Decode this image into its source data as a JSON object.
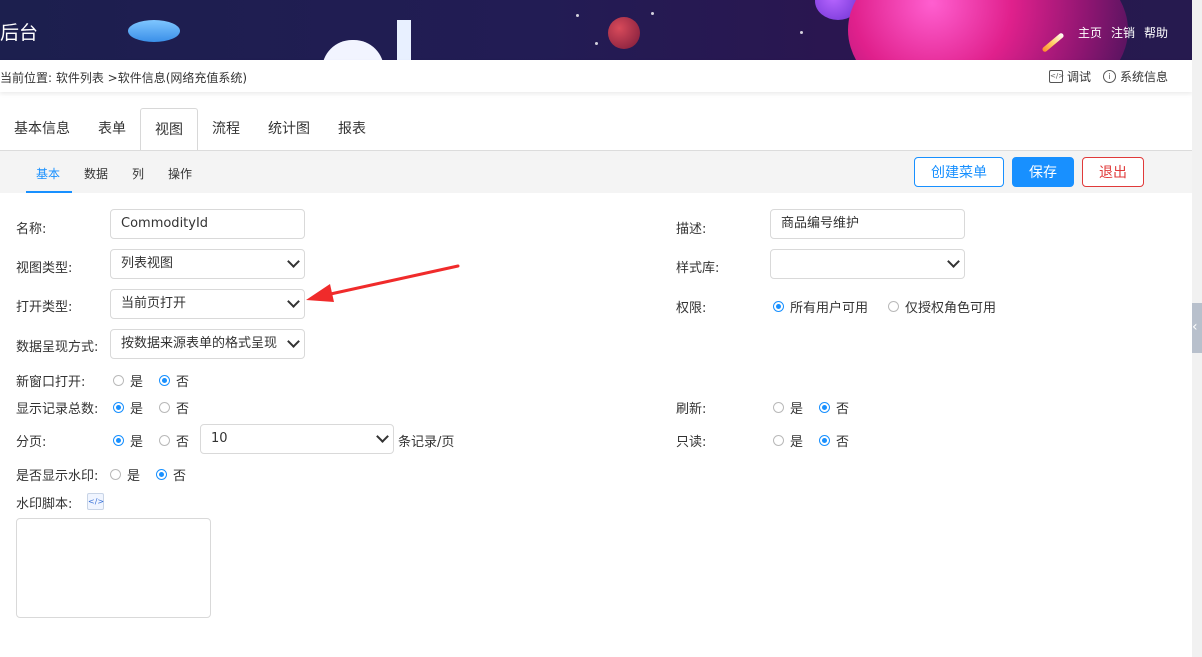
{
  "header": {
    "title_fragment": "后台",
    "nav": [
      "主页",
      "注销",
      "帮助"
    ]
  },
  "breadcrumb": {
    "text": "当前位置: 软件列表 >软件信息(网络充值系统)"
  },
  "toolbar": {
    "debug_label": "调试",
    "sysinfo_label": "系统信息"
  },
  "tabs": [
    "基本信息",
    "表单",
    "视图",
    "流程",
    "统计图",
    "报表"
  ],
  "active_tab": "视图",
  "subtabs": [
    "基本",
    "数据",
    "列",
    "操作"
  ],
  "active_subtab": "基本",
  "buttons": {
    "create_menu": "创建菜单",
    "save": "保存",
    "exit": "退出"
  },
  "form": {
    "name_label": "名称:",
    "name_value": "CommodityId",
    "desc_label": "描述:",
    "desc_value": "商品编号维护",
    "view_type_label": "视图类型:",
    "view_type_value": "列表视图",
    "style_lib_label": "样式库:",
    "style_lib_value": "",
    "open_type_label": "打开类型:",
    "open_type_value": "当前页打开",
    "permission_label": "权限:",
    "permission_all": "所有用户可用",
    "permission_roles": "仅授权角色可用",
    "presentation_label": "数据呈现方式:",
    "presentation_value": "按数据来源表单的格式呈现",
    "new_window_label": "新窗口打开:",
    "show_total_label": "显示记录总数:",
    "refresh_label": "刷新:",
    "paging_label": "分页:",
    "page_size_value": "10",
    "page_size_unit": "条记录/页",
    "readonly_label": "只读:",
    "watermark_label": "是否显示水印:",
    "watermark_script_label": "水印脚本:",
    "yes": "是",
    "no": "否"
  },
  "colors": {
    "primary": "#1890ff",
    "danger": "#e03a3a",
    "header_bg": "#1c1f4e"
  }
}
